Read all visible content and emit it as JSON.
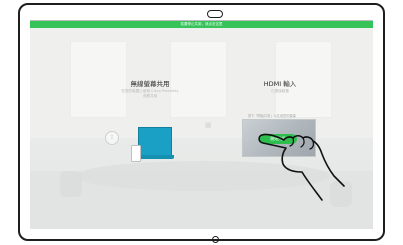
{
  "status_bar": {
    "text": "若要停止共用，请点击这里"
  },
  "wireless_share": {
    "title": "無線螢幕共用",
    "description_line1": "在您的裝置上使用 Cisco Proximity",
    "description_line2": "查看共用"
  },
  "hdmi_input": {
    "title": "HDMI 輸入",
    "description": "已連接裝置",
    "preview_label": "按下「開始共用」以共用您的螢幕",
    "start_button_label": "開始共用"
  },
  "colors": {
    "accent": "#2dbe4f",
    "status_bar": "#36c45a",
    "laptop": "#1aa0c4"
  },
  "icons": [
    "camera-icon",
    "home-button-icon",
    "share-icon",
    "laptop-icon",
    "phone-icon",
    "pointing-hand-icon"
  ]
}
